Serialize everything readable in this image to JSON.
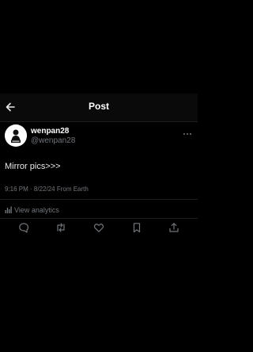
{
  "header": {
    "title": "Post"
  },
  "post": {
    "display_name": "wenpan28",
    "handle": "@wenpan28",
    "text": "Mirror pics>>>",
    "time": "9:16 PM · 8/22/24 From Earth",
    "analytics_label": "View analytics"
  },
  "icons": {
    "back": "arrow-left-icon",
    "more": "more-horizontal-icon",
    "analytics": "bar-chart-icon",
    "reply": "reply-icon",
    "repost": "repost-icon",
    "like": "heart-icon",
    "bookmark": "bookmark-icon",
    "share": "share-icon"
  },
  "colors": {
    "background": "#000000",
    "text_primary": "#e7e9ea",
    "text_secondary": "#71767b",
    "divider": "#1f1f1f"
  }
}
